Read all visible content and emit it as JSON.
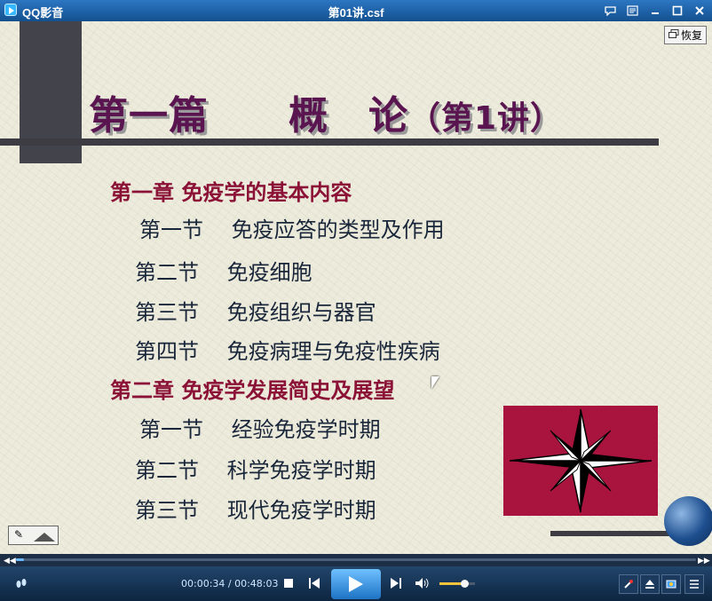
{
  "window": {
    "app_name": "QQ影音",
    "file_title": "第01讲.csf"
  },
  "slide": {
    "title_main": "第一篇　　概　论",
    "title_lesson": "（第1讲）",
    "restore_label": "恢复",
    "chapters": [
      {
        "label": "第一章  免疫学的基本内容",
        "sections": [
          "第一节　 免疫应答的类型及作用",
          "第二节　 免疫细胞",
          "第三节　 免疫组织与器官",
          "第四节　 免疫病理与免疫性疾病"
        ]
      },
      {
        "label": "第二章  免疫学发展简史及展望",
        "sections": [
          "第一节　 经验免疫学时期",
          "第二节　 科学免疫学时期",
          "第三节　 现代免疫学时期"
        ]
      }
    ]
  },
  "player": {
    "time_display": "00:00:34 / 00:48:03",
    "progress": 0.012,
    "volume": 0.7
  }
}
